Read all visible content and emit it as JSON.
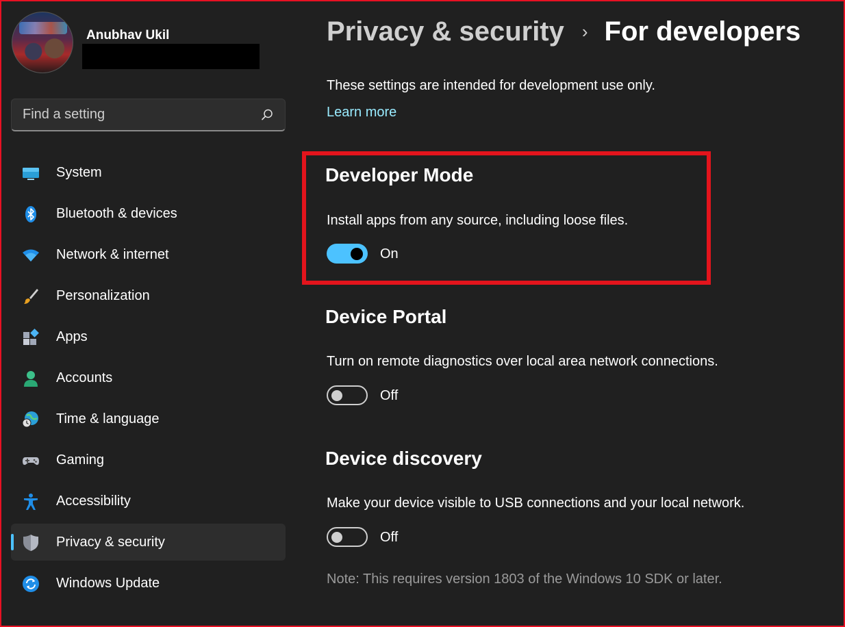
{
  "user": {
    "name": "Anubhav Ukil"
  },
  "search": {
    "placeholder": "Find a setting",
    "icon": "search-icon"
  },
  "sidebar": {
    "items": [
      {
        "label": "System",
        "icon": "system-icon"
      },
      {
        "label": "Bluetooth & devices",
        "icon": "bluetooth-icon"
      },
      {
        "label": "Network & internet",
        "icon": "wifi-icon"
      },
      {
        "label": "Personalization",
        "icon": "brush-icon"
      },
      {
        "label": "Apps",
        "icon": "apps-icon"
      },
      {
        "label": "Accounts",
        "icon": "accounts-icon"
      },
      {
        "label": "Time & language",
        "icon": "time-language-icon"
      },
      {
        "label": "Gaming",
        "icon": "gamepad-icon"
      },
      {
        "label": "Accessibility",
        "icon": "accessibility-icon"
      },
      {
        "label": "Privacy & security",
        "icon": "shield-icon",
        "selected": true
      },
      {
        "label": "Windows Update",
        "icon": "windows-update-icon"
      }
    ]
  },
  "breadcrumb": {
    "parent": "Privacy & security",
    "separator": "›",
    "current": "For developers"
  },
  "intro": {
    "text": "These settings are intended for development use only.",
    "link": "Learn more"
  },
  "sections": {
    "developer_mode": {
      "title": "Developer Mode",
      "description": "Install apps from any source, including loose files.",
      "state": "On"
    },
    "device_portal": {
      "title": "Device Portal",
      "description": "Turn on remote diagnostics over local area network connections.",
      "state": "Off"
    },
    "device_discovery": {
      "title": "Device discovery",
      "description": "Make your device visible to USB connections and your local network.",
      "state": "Off",
      "note": "Note: This requires version 1803 of the Windows 10 SDK or later."
    }
  },
  "colors": {
    "background": "#202020",
    "accent": "#4cc2ff",
    "link": "#99ebff",
    "highlight": "#e3141c"
  }
}
